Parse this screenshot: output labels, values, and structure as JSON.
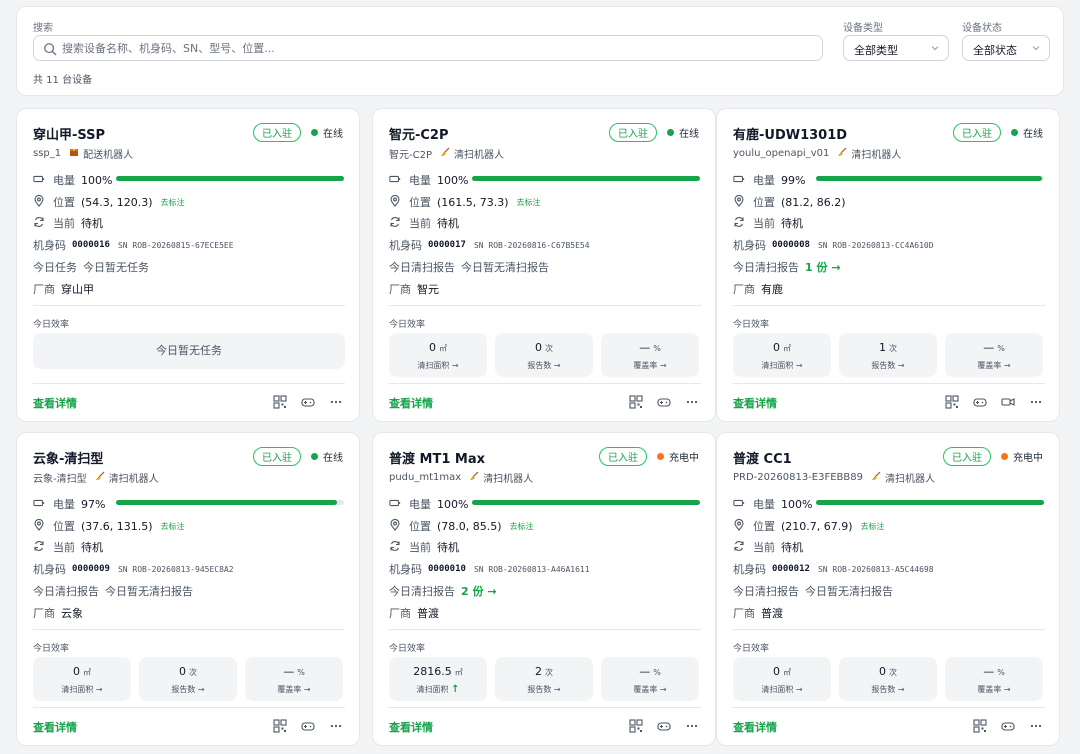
{
  "filters": {
    "search_label": "搜索",
    "search_placeholder": "搜索设备名称、机身码、SN、型号、位置...",
    "type_label": "设备类型",
    "type_value": "全部类型",
    "status_label": "设备状态",
    "status_value": "全部状态",
    "count_text": "共 11 台设备"
  },
  "colors": {
    "accent": "#16a34a",
    "online": "#16a34a",
    "charging": "#f97316"
  },
  "labels": {
    "battery": "电量",
    "position": "位置",
    "current": "当前",
    "code": "机身码",
    "vendor": "厂商",
    "efficiency": "今日效率",
    "detail": "查看详情",
    "mark": "去标注",
    "sn_prefix": "SN"
  },
  "cards": [
    {
      "name": "穿山甲-SSP",
      "badge": "已入驻",
      "status": "在线",
      "status_kind": "online",
      "sub": "ssp_1",
      "type_icon": "package-icon",
      "type": "配送机器人",
      "battery": "100%",
      "battery_value": 100,
      "position": "(54.3, 120.3)",
      "mark": "去标注",
      "current": "待机",
      "code": "0000016",
      "sn": "ROB-20260815-67ECE5EE",
      "task_label": "今日任务",
      "task_value": "今日暂无任务",
      "vendor": "穿山甲",
      "empty": "今日暂无任务",
      "icons": [
        "qrcode-icon",
        "gamepad-icon",
        "more-icon"
      ]
    },
    {
      "name": "智元-C2P",
      "badge": "已入驻",
      "status": "在线",
      "status_kind": "online",
      "sub": "智元-C2P",
      "type_icon": "broom-icon",
      "type": "清扫机器人",
      "battery": "100%",
      "battery_value": 100,
      "position": "(161.5, 73.3)",
      "mark": "去标注",
      "current": "待机",
      "code": "0000017",
      "sn": "ROB-20260816-C67B5E54",
      "task_label": "今日清扫报告",
      "task_value": "今日暂无清扫报告",
      "vendor": "智元",
      "tiles": [
        {
          "value": "0",
          "unit": "㎡",
          "label": "清扫面积 →"
        },
        {
          "value": "0",
          "unit": "次",
          "label": "报告数 →"
        },
        {
          "value": "—",
          "unit": "%",
          "label": "覆盖率 →"
        }
      ],
      "icons": [
        "qrcode-icon",
        "gamepad-icon",
        "more-icon"
      ]
    },
    {
      "name": "有鹿-UDW1301D",
      "badge": "已入驻",
      "status": "在线",
      "status_kind": "online",
      "sub": "youlu_openapi_v01",
      "type_icon": "broom-icon",
      "type": "清扫机器人",
      "battery": "99%",
      "battery_value": 99,
      "position": "(81.2, 86.2)",
      "current": "待机",
      "code": "0000008",
      "sn": "ROB-20260813-CC4A610D",
      "task_label": "今日清扫报告",
      "task_link": "1 份 →",
      "vendor": "有鹿",
      "tiles": [
        {
          "value": "0",
          "unit": "㎡",
          "label": "清扫面积 →"
        },
        {
          "value": "1",
          "unit": "次",
          "label": "报告数 →"
        },
        {
          "value": "—",
          "unit": "%",
          "label": "覆盖率 →"
        }
      ],
      "icons": [
        "qrcode-icon",
        "gamepad-icon",
        "video-icon",
        "more-icon"
      ]
    },
    {
      "name": "云象-清扫型",
      "badge": "已入驻",
      "status": "在线",
      "status_kind": "online",
      "sub": "云象-清扫型",
      "type_icon": "broom-icon",
      "type": "清扫机器人",
      "battery": "97%",
      "battery_value": 97,
      "position": "(37.6, 131.5)",
      "mark": "去标注",
      "current": "待机",
      "code": "0000009",
      "sn": "ROB-20260813-945EC8A2",
      "task_label": "今日清扫报告",
      "task_value": "今日暂无清扫报告",
      "vendor": "云象",
      "tiles": [
        {
          "value": "0",
          "unit": "㎡",
          "label": "清扫面积 →"
        },
        {
          "value": "0",
          "unit": "次",
          "label": "报告数 →"
        },
        {
          "value": "—",
          "unit": "%",
          "label": "覆盖率 →"
        }
      ],
      "icons": [
        "qrcode-icon",
        "gamepad-icon",
        "more-icon"
      ]
    },
    {
      "name": "普渡 MT1 Max",
      "badge": "已入驻",
      "status": "充电中",
      "status_kind": "charging",
      "sub": "pudu_mt1max",
      "type_icon": "broom-icon",
      "type": "清扫机器人",
      "battery": "100%",
      "battery_value": 100,
      "position": "(78.0, 85.5)",
      "mark": "去标注",
      "current": "待机",
      "code": "0000010",
      "sn": "ROB-20260813-A46A1611",
      "task_label": "今日清扫报告",
      "task_link": "2 份 →",
      "vendor": "普渡",
      "tiles": [
        {
          "value": "2816.5",
          "unit": "㎡",
          "label": "清扫面积",
          "arrow_up": "↑"
        },
        {
          "value": "2",
          "unit": "次",
          "label": "报告数 →"
        },
        {
          "value": "—",
          "unit": "%",
          "label": "覆盖率 →"
        }
      ],
      "icons": [
        "qrcode-icon",
        "gamepad-icon",
        "more-icon"
      ]
    },
    {
      "name": "普渡 CC1",
      "badge": "已入驻",
      "status": "充电中",
      "status_kind": "charging",
      "sub": "PRD-20260813-E3FEBB89",
      "type_icon": "broom-icon",
      "type": "清扫机器人",
      "battery": "100%",
      "battery_value": 100,
      "position": "(210.7, 67.9)",
      "mark": "去标注",
      "current": "待机",
      "code": "0000012",
      "sn": "ROB-20260813-A5C44698",
      "task_label": "今日清扫报告",
      "task_value": "今日暂无清扫报告",
      "vendor": "普渡",
      "tiles": [
        {
          "value": "0",
          "unit": "㎡",
          "label": "清扫面积 →"
        },
        {
          "value": "0",
          "unit": "次",
          "label": "报告数 →"
        },
        {
          "value": "—",
          "unit": "%",
          "label": "覆盖率 →"
        }
      ],
      "icons": [
        "qrcode-icon",
        "gamepad-icon",
        "more-icon"
      ]
    }
  ]
}
